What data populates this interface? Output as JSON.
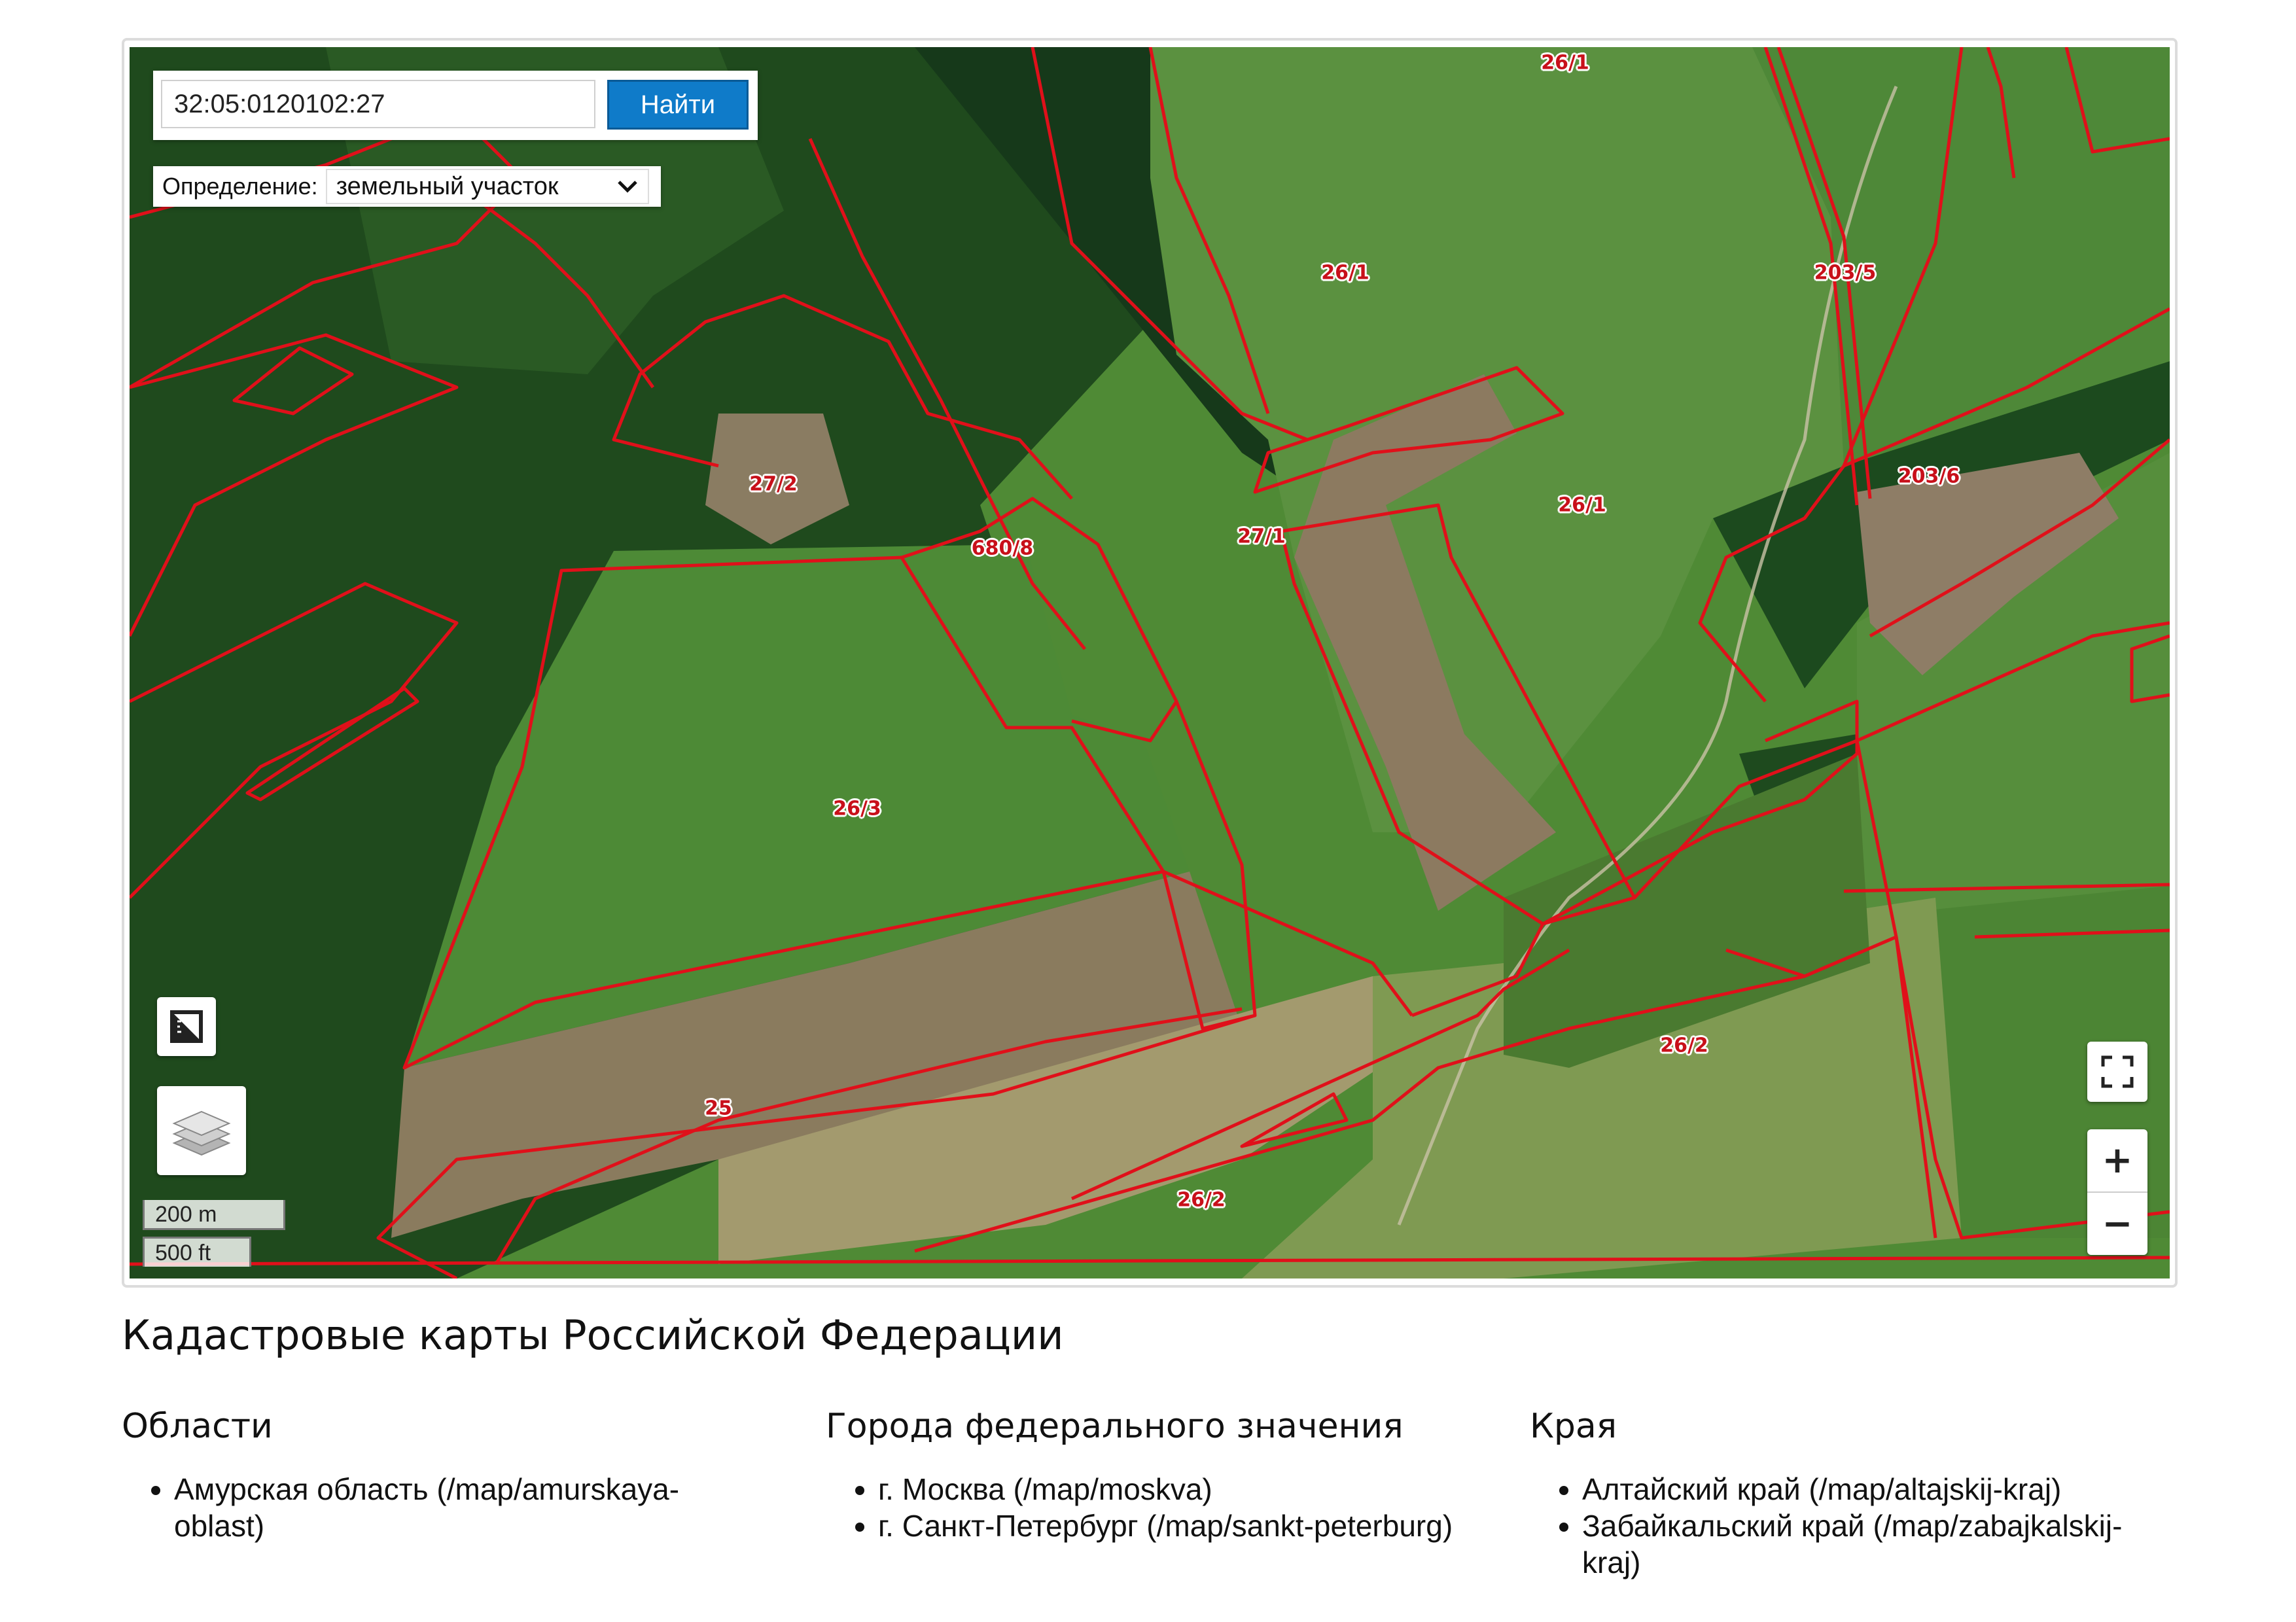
{
  "search": {
    "value": "32:05:0120102:27",
    "button_label": "Найти"
  },
  "definition": {
    "label": "Определение:",
    "selected": "земельный участок"
  },
  "map": {
    "parcels": [
      {
        "label": "26/1"
      },
      {
        "label": "26/1"
      },
      {
        "label": "203/5"
      },
      {
        "label": "203/6"
      },
      {
        "label": "26/1"
      },
      {
        "label": "27/2"
      },
      {
        "label": "680/8"
      },
      {
        "label": "27/1"
      },
      {
        "label": "26/3"
      },
      {
        "label": "26/2"
      },
      {
        "label": "25"
      },
      {
        "label": "26/2"
      }
    ],
    "controls": {
      "zoom_in": "+",
      "zoom_out": "−"
    },
    "scale": {
      "metric": "200 m",
      "imperial": "500 ft"
    },
    "colors": {
      "boundary": "#e0101a",
      "forest": "#1f4a1d",
      "field": "#4f8a35",
      "bare": "#8c7a60"
    }
  },
  "page": {
    "title": "Кадастровые карты Российской Федерации",
    "columns": [
      {
        "heading": "Области",
        "items": [
          "Амурская область (/map/amurskaya-oblast)"
        ]
      },
      {
        "heading": "Города федерального значения",
        "items": [
          "г. Москва (/map/moskva)",
          "г. Санкт-Петербург (/map/sankt-peterburg)"
        ]
      },
      {
        "heading": "Края",
        "items": [
          "Алтайский край (/map/altajskij-kraj)",
          "Забайкальский край (/map/zabajkalskij-kraj)"
        ]
      }
    ]
  }
}
